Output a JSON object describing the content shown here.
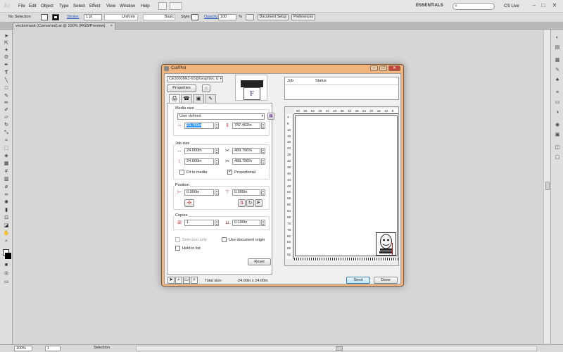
{
  "app": {
    "logo": "Ai",
    "menu": [
      "File",
      "Edit",
      "Object",
      "Type",
      "Select",
      "Effect",
      "View",
      "Window",
      "Help"
    ],
    "workspace": "ESSENTIALS",
    "search_placeholder": "",
    "cs_live": "CS Live",
    "window_controls": [
      "–",
      "□",
      "✕"
    ]
  },
  "control_bar": {
    "selection": "No Selection",
    "stroke_label": "Stroke:",
    "stroke_weight": "1 pt",
    "stroke_profile": "Uniform",
    "brush": "Basic",
    "style_label": "Style:",
    "opacity_label": "Opacity:",
    "opacity_value": "100",
    "opacity_unit": "%",
    "document_setup": "Document Setup",
    "preferences": "Preferences"
  },
  "document_tab": {
    "label": "vectormask (Converted).ai @ 100% (RGB/Preview)",
    "close": "×"
  },
  "status_bar": {
    "zoom": "100%",
    "artboard": "1",
    "mode": "Selection"
  },
  "dialog": {
    "title": "Cut/Plot",
    "device": "CE3000Mk2-60@Graphtec U",
    "properties_button": "Properties",
    "media_size": {
      "label": "Media size",
      "option": "User defined",
      "width": "23.760in",
      "length": "787.402in"
    },
    "job_size": {
      "label": "Job size",
      "width": "24.000in",
      "width_pct": "489.796%",
      "height": "24.000in",
      "height_pct": "489.796%",
      "fit_to_media": "Fit to media",
      "proportional": "Proportional",
      "proportional_checked": true,
      "fit_checked": false
    },
    "position": {
      "label": "Position",
      "x": "0.000in",
      "y": "0.000in"
    },
    "copies": {
      "label": "Copies",
      "count": "1",
      "spacing": "0.100in"
    },
    "selection_only": "Selection only",
    "use_document_origin": "Use document origin",
    "hold_in_list": "Hold in list",
    "reset": "Reset",
    "job_list": {
      "col_job": "Job",
      "col_status": "Status"
    },
    "ruler_top": [
      "60",
      "56",
      "52",
      "48",
      "44",
      "40",
      "36",
      "32",
      "28",
      "24",
      "20",
      "16",
      "12",
      "8"
    ],
    "ruler_left": [
      "4",
      "8",
      "12",
      "16",
      "20",
      "24",
      "28",
      "32",
      "36",
      "40",
      "44",
      "48",
      "52",
      "56",
      "60",
      "64",
      "68",
      "72",
      "76",
      "80",
      "84",
      "88",
      "92"
    ],
    "total_size_label": "Total size:",
    "total_size_value": "24.00in x 24.00in",
    "send": "Send",
    "done": "Done"
  }
}
